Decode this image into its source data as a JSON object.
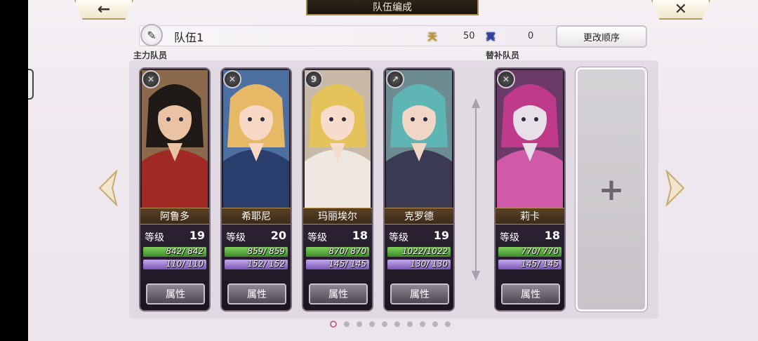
{
  "header": {
    "title": "队伍编成",
    "back_icon": "←",
    "close_icon": "✕"
  },
  "team": {
    "name": "队伍1",
    "sky_icon": "天",
    "sky_value": "50",
    "earth_icon": "冥",
    "earth_value": "0",
    "reorder_label": "更改顺序",
    "edit_icon": "✎"
  },
  "sections": {
    "main": "主力队员",
    "sub": "替补队员"
  },
  "members": [
    {
      "name": "阿鲁多",
      "level_label": "等级",
      "level": "19",
      "hp": "842/ 842",
      "mp": "110/ 110",
      "attr": "属性",
      "type_icon": "✕",
      "colors": {
        "hair": "#1f1a18",
        "skin": "#e9c3a4",
        "cloth": "#a12a24",
        "bg": "#8a6a4a"
      }
    },
    {
      "name": "希耶尼",
      "level_label": "等级",
      "level": "20",
      "hp": "859/ 859",
      "mp": "152/ 152",
      "attr": "属性",
      "type_icon": "✕",
      "colors": {
        "hair": "#e7b865",
        "skin": "#f6d8c4",
        "cloth": "#2a3e6e",
        "bg": "#4a6fa0"
      }
    },
    {
      "name": "玛丽埃尔",
      "level_label": "等级",
      "level": "18",
      "hp": "870/ 870",
      "mp": "145/ 145",
      "attr": "属性",
      "type_icon": "9",
      "colors": {
        "hair": "#e6c35a",
        "skin": "#f7dccb",
        "cloth": "#efe7e2",
        "bg": "#c8b9a6"
      }
    },
    {
      "name": "克罗德",
      "level_label": "等级",
      "level": "19",
      "hp": "1022/1022",
      "mp": "130/ 130",
      "attr": "属性",
      "type_icon": "↗",
      "colors": {
        "hair": "#5fb4b4",
        "skin": "#f1d6c6",
        "cloth": "#3a3a52",
        "bg": "#6d8c92"
      }
    },
    {
      "name": "莉卡",
      "level_label": "等级",
      "level": "18",
      "hp": "770/ 770",
      "mp": "145/ 145",
      "attr": "属性",
      "type_icon": "✕",
      "colors": {
        "hair": "#c03a8c",
        "skin": "#e8e0e8",
        "cloth": "#d05aa8",
        "bg": "#6b3a66"
      }
    }
  ],
  "empty_slot": {
    "plus_icon": "+"
  },
  "pagination": {
    "total": 10,
    "active": 0
  }
}
